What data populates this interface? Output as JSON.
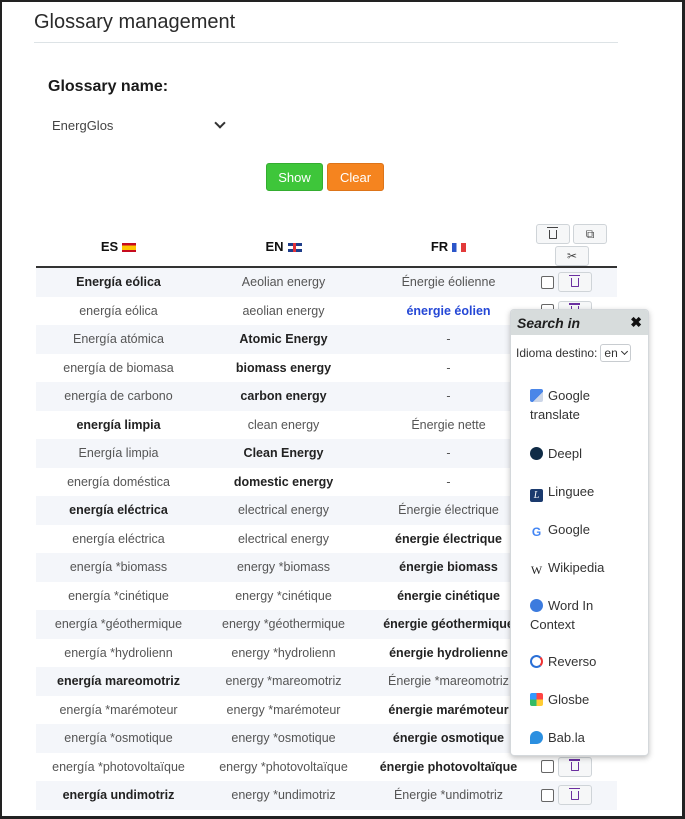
{
  "page": {
    "title": "Glossary management"
  },
  "form": {
    "glossary_label": "Glossary name:",
    "glossary_value": "EnergGlos",
    "show_label": "Show",
    "clear_label": "Clear"
  },
  "table": {
    "columns": [
      {
        "code": "ES",
        "flag": "spain-flag"
      },
      {
        "code": "EN",
        "flag": "uk-flag"
      },
      {
        "code": "FR",
        "flag": "france-flag"
      }
    ],
    "toolbar": {
      "delete_icon": "trash-icon",
      "copy_icon": "copy-icon",
      "cut_icon": "scissors-icon"
    },
    "rows": [
      {
        "es": "Energía eólica",
        "en": "Aeolian energy",
        "fr": "Énergie éolienne",
        "bold": "es"
      },
      {
        "es": "energía eólica",
        "en": "aeolian energy",
        "fr": "énergie éolien",
        "bold": "fr-link"
      },
      {
        "es": "Energía atómica",
        "en": "Atomic Energy",
        "fr": "-",
        "bold": "en"
      },
      {
        "es": "energía de biomasa",
        "en": "biomass energy",
        "fr": "-",
        "bold": "en"
      },
      {
        "es": "energía de carbono",
        "en": "carbon energy",
        "fr": "-",
        "bold": "en"
      },
      {
        "es": "energía limpia",
        "en": "clean energy",
        "fr": "Énergie nette",
        "bold": "es"
      },
      {
        "es": "Energía limpia",
        "en": "Clean Energy",
        "fr": "-",
        "bold": "en"
      },
      {
        "es": "energía doméstica",
        "en": "domestic energy",
        "fr": "-",
        "bold": "en"
      },
      {
        "es": "energía eléctrica",
        "en": "electrical energy",
        "fr": "Énergie électrique",
        "bold": "es"
      },
      {
        "es": "energía eléctrica",
        "en": "electrical energy",
        "fr": "énergie électrique",
        "bold": "fr"
      },
      {
        "es": "energía *biomass",
        "en": "energy *biomass",
        "fr": "énergie biomass",
        "bold": "fr"
      },
      {
        "es": "energía *cinétique",
        "en": "energy *cinétique",
        "fr": "énergie cinétique",
        "bold": "fr"
      },
      {
        "es": "energía *géothermique",
        "en": "energy *géothermique",
        "fr": "énergie géothermique",
        "bold": "fr"
      },
      {
        "es": "energía *hydrolienn",
        "en": "energy *hydrolienn",
        "fr": "énergie hydrolienne",
        "bold": "fr"
      },
      {
        "es": "energía mareomotriz",
        "en": "energy *mareomotriz",
        "fr": "Énergie *mareomotriz",
        "bold": "es"
      },
      {
        "es": "energía *marémoteur",
        "en": "energy *marémoteur",
        "fr": "énergie marémoteur",
        "bold": "fr"
      },
      {
        "es": "energía *osmotique",
        "en": "energy *osmotique",
        "fr": "énergie osmotique",
        "bold": "fr"
      },
      {
        "es": "energía *photovoltaïque",
        "en": "energy *photovoltaïque",
        "fr": "énergie photovoltaïque",
        "bold": "fr"
      },
      {
        "es": "energía undimotriz",
        "en": "energy *undimotriz",
        "fr": "Énergie *undimotriz",
        "bold": "es"
      }
    ]
  },
  "popup": {
    "title": "Search in",
    "dest_label": "Idioma destino:",
    "dest_value": "en",
    "services": [
      {
        "label": "Google translate",
        "icon": "google-translate-icon"
      },
      {
        "label": "Deepl",
        "icon": "deepl-icon"
      },
      {
        "label": "Linguee",
        "icon": "linguee-icon"
      },
      {
        "label": "Google",
        "icon": "google-icon"
      },
      {
        "label": "Wikipedia",
        "icon": "wikipedia-icon"
      },
      {
        "label": "Word In Context",
        "icon": "word-in-context-icon"
      },
      {
        "label": "Reverso",
        "icon": "reverso-icon"
      },
      {
        "label": "Glosbe",
        "icon": "glosbe-icon"
      },
      {
        "label": "Bab.la",
        "icon": "babla-icon"
      }
    ]
  },
  "colors": {
    "show_button": "#3ec63a",
    "clear_button": "#f5841f",
    "link_text": "#2447d6",
    "trash_icon": "#6b2fa0"
  }
}
